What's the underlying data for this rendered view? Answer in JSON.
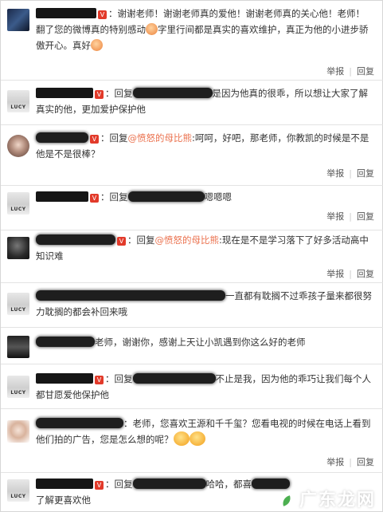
{
  "actions": {
    "report": "举报",
    "reply": "回复"
  },
  "vip_badge": "V",
  "reply_prefix": "回复",
  "comments": [
    {
      "id": 1,
      "text_a": "：谢谢老师！谢谢老师真的爱他！谢谢老师真的关心他！老师！",
      "text_b": "翻了您的微博真的特别感动",
      "text_c": "字里行间都是真实的喜欢维护，真正为他的小进步骄傲开心。真好"
    },
    {
      "id": 2,
      "text": "是因为他真的很乖，所以想让大家了解真实的他，更加爱护保护他"
    },
    {
      "id": 3,
      "at": "@愤怒的母比熊",
      "text": ":呵呵，好吧，那老师，你教凯的时候是不是他是不是很棒？"
    },
    {
      "id": 4,
      "text": "嗯嗯嗯"
    },
    {
      "id": 5,
      "at": "@愤怒的母比熊",
      "text": ":现在是不是学习落下了好多活动高中知识难",
      "name_hint": "14109_9"
    },
    {
      "id": 6,
      "text": "一直都有耽搁不过乖孩子量来都很努力耽搁的都会补回来哦"
    },
    {
      "id": 7,
      "text": "老师，谢谢你，感谢上天让小凯遇到你这么好的老师"
    },
    {
      "id": 8,
      "text": "不止是我，因为他的乖巧让我们每个人都甘愿爱他保护他"
    },
    {
      "id": 9,
      "text": "：老师，您喜欢王源和千千玺？您看电视的时候在电话上看到他们拍的广告，您是怎么想的呢？"
    },
    {
      "id": 10,
      "text_a": "哈哈，都喜",
      "text_b": "了解更喜欢他"
    }
  ],
  "avatar_labels": {
    "lucy": "LUCY"
  },
  "watermark": "广东龙网"
}
